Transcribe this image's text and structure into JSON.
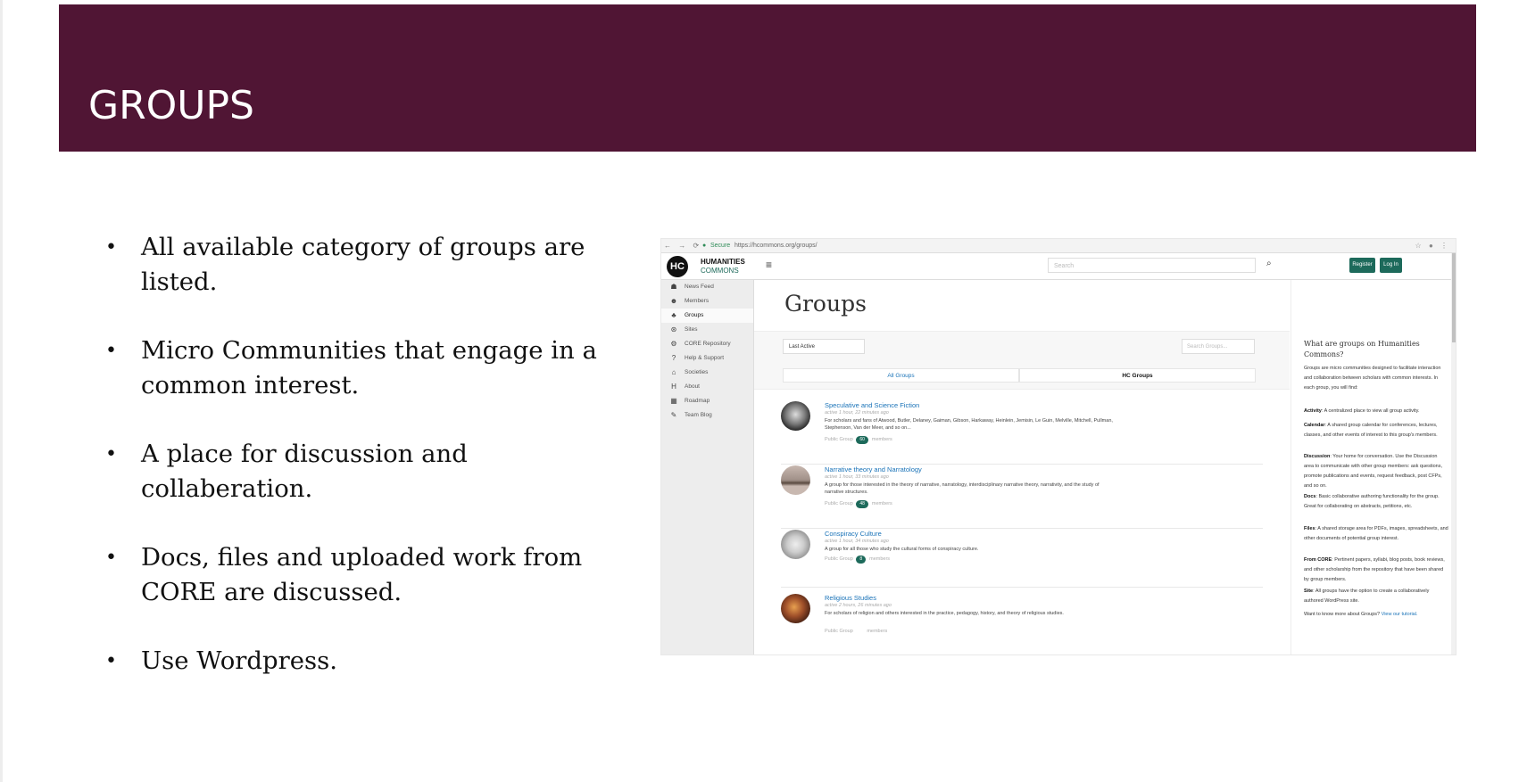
{
  "slide": {
    "title": "GROUPS",
    "bullets": [
      "All available category of groups are listed.",
      "Micro Communities that engage in a common interest.",
      "A place for discussion and collaberation.",
      "Docs, files and uploaded work from CORE are discussed.",
      "Use Wordpress."
    ],
    "colors": {
      "title_band": "#501534",
      "accent_green": "#1d6a5b",
      "link_blue": "#1a73b8"
    }
  },
  "screenshot": {
    "browser": {
      "secure_label": "Secure",
      "url_prefix": "https://",
      "url": "hcommons.org/groups/"
    },
    "header": {
      "logo_mark": "HC",
      "logo_line1": "HUMANITIES",
      "logo_line2": "COMMONS",
      "menu_icon": "hamburger-icon",
      "search_placeholder": "Search",
      "register_label": "Register",
      "login_label": "Log In"
    },
    "sidebar": [
      {
        "label": "News Feed",
        "icon": "comments-icon"
      },
      {
        "label": "Members",
        "icon": "users-icon"
      },
      {
        "label": "Groups",
        "icon": "groups-icon",
        "active": true
      },
      {
        "label": "Sites",
        "icon": "wordpress-icon"
      },
      {
        "label": "CORE Repository",
        "icon": "gears-icon"
      },
      {
        "label": "Help & Support",
        "icon": "question-icon"
      },
      {
        "label": "Societies",
        "icon": "institution-icon"
      },
      {
        "label": "About",
        "icon": "h-icon"
      },
      {
        "label": "Roadmap",
        "icon": "map-icon"
      },
      {
        "label": "Team Blog",
        "icon": "edit-icon"
      }
    ],
    "main": {
      "heading": "Groups",
      "sort_select": "Last Active",
      "search_groups_placeholder": "Search Groups...",
      "tabs": [
        "All Groups",
        "HC Groups"
      ],
      "groups": [
        {
          "name": "Speculative and Science Fiction",
          "active": "active 1 hour, 22 minutes ago",
          "description": "For scholars and fans of Atwood, Butler, Delaney, Gaiman, Gibson, Harkaway, Heinlein, Jemisin, Le Guin, Melville, Mitchell, Pullman, Stephenson, Van der Meer, and so on...",
          "type": "Public Group",
          "members_count": "60",
          "members_label": "members"
        },
        {
          "name": "Narrative theory and Narratology",
          "active": "active 1 hour, 33 minutes ago",
          "description": "A group for those interested in the theory of narrative, narratology, interdisciplinary narrative theory, narrativity, and the study of narrative structures.",
          "type": "Public Group",
          "members_count": "48",
          "members_label": "members"
        },
        {
          "name": "Conspiracy Culture",
          "active": "active 1 hour, 34 minutes ago",
          "description": "A group for all those who study the cultural forms of conspiracy culture.",
          "type": "Public Group",
          "members_count": "8",
          "members_label": "members"
        },
        {
          "name": "Religious Studies",
          "active": "active 2 hours, 26 minutes ago",
          "description": "For scholars of religion and others interested in the practice, pedagogy, history, and theory of religious studies.",
          "type": "Public Group",
          "members_count": "",
          "members_label": "members"
        }
      ]
    },
    "aside": {
      "heading": "What are groups on Humanities Commons?",
      "intro": "Groups are micro communities designed to facilitate interaction and collaboration between scholars with common interests. In each group, you will find:",
      "items": [
        {
          "term": "Activity",
          "text": ": A centralized place to view all group activity."
        },
        {
          "term": "Calendar",
          "text": ": A shared group calendar for conferences, lectures, classes, and other events of interest to this group's members."
        },
        {
          "term": "Discussion",
          "text": ": Your home for conversation. Use the Discussion area to communicate with other group members: ask questions, promote publications and events, request feedback, post CFPs, and so on."
        },
        {
          "term": "Docs",
          "text": ": Basic collaborative authoring functionality for the group. Great for collaborating on abstracts, petitions, etc."
        },
        {
          "term": "Files",
          "text": ": A shared storage area for PDFs, images, spreadsheets, and other documents of potential group interest."
        },
        {
          "term": "From CORE",
          "text": ": Pertinent papers, syllabi, blog posts, book reviews, and other scholarship from the repository that have been shared by group members."
        },
        {
          "term": "Site",
          "text": ": All groups have the option to create a collaboratively authored WordPress site."
        }
      ],
      "more_text": "Want to know more about Groups?",
      "more_link": "View our tutorial."
    }
  }
}
